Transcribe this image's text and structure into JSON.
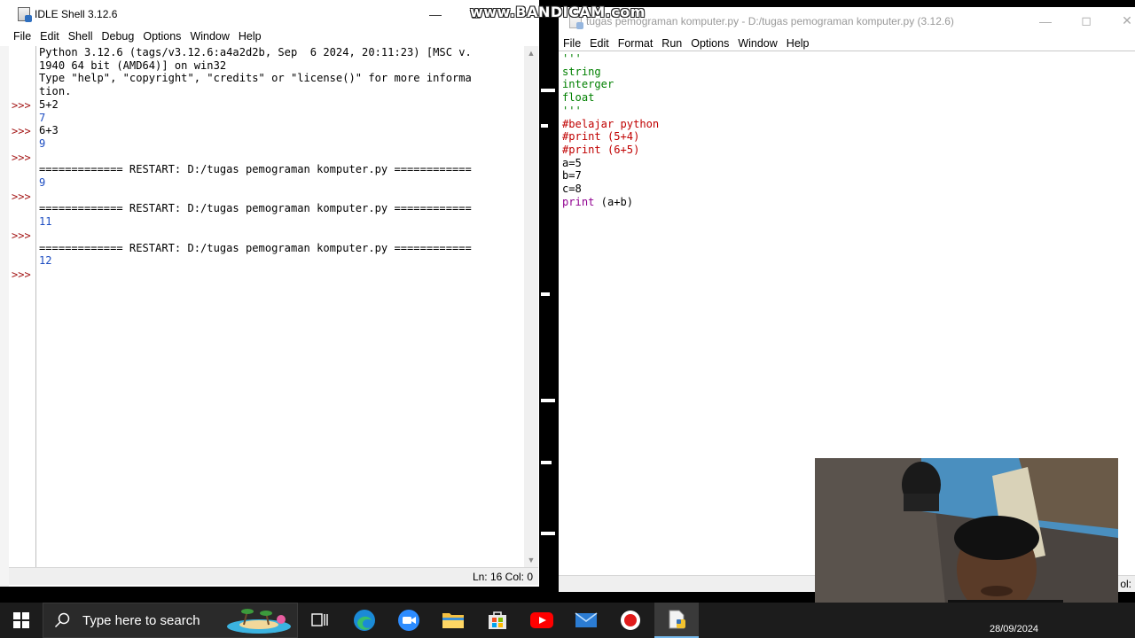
{
  "shell_window": {
    "title": "IDLE Shell 3.12.6",
    "menu": [
      "File",
      "Edit",
      "Shell",
      "Debug",
      "Options",
      "Window",
      "Help"
    ],
    "prompt": ">>>",
    "lines": [
      {
        "text": "Python 3.12.6 (tags/v3.12.6:a4a2d2b, Sep  6 2024, 20:11:23) [MSC v.",
        "kind": "plain"
      },
      {
        "text": "1940 64 bit (AMD64)] on win32",
        "kind": "plain"
      },
      {
        "text": "Type \"help\", \"copyright\", \"credits\" or \"license()\" for more informa",
        "kind": "plain"
      },
      {
        "text": "tion.",
        "kind": "plain"
      },
      {
        "text": "5+2",
        "kind": "input"
      },
      {
        "text": "7",
        "kind": "output"
      },
      {
        "text": "6+3",
        "kind": "input"
      },
      {
        "text": "9",
        "kind": "output"
      },
      {
        "text": "",
        "kind": "input"
      },
      {
        "text": "============= RESTART: D:/tugas pemograman komputer.py ============",
        "kind": "plain"
      },
      {
        "text": "9",
        "kind": "output"
      },
      {
        "text": "",
        "kind": "input"
      },
      {
        "text": "============= RESTART: D:/tugas pemograman komputer.py ============",
        "kind": "plain"
      },
      {
        "text": "11",
        "kind": "output"
      },
      {
        "text": "",
        "kind": "input"
      },
      {
        "text": "============= RESTART: D:/tugas pemograman komputer.py ============",
        "kind": "plain"
      },
      {
        "text": "12",
        "kind": "output"
      },
      {
        "text": "",
        "kind": "input"
      }
    ],
    "status": "Ln: 16   Col: 0"
  },
  "editor_window": {
    "title": "tugas pemograman komputer.py - D:/tugas pemograman komputer.py (3.12.6)",
    "menu": [
      "File",
      "Edit",
      "Format",
      "Run",
      "Options",
      "Window",
      "Help"
    ],
    "lines": [
      {
        "text": "'''",
        "kind": "str"
      },
      {
        "text": "string",
        "kind": "str"
      },
      {
        "text": "interger",
        "kind": "str"
      },
      {
        "text": "float",
        "kind": "str"
      },
      {
        "text": "'''",
        "kind": "str"
      },
      {
        "text": "#belajar python",
        "kind": "comment"
      },
      {
        "text": "#print (5+4)",
        "kind": "comment"
      },
      {
        "text": "#print (6+5)",
        "kind": "comment"
      },
      {
        "text": "a=5",
        "kind": "plain"
      },
      {
        "text": "b=7",
        "kind": "plain"
      },
      {
        "text": "c=8",
        "kind": "plain"
      },
      {
        "text": "print (a+b)",
        "kind": "builtin_call",
        "keyword": "print",
        "rest": " (a+b)"
      }
    ],
    "status": "ol:"
  },
  "watermark": "www.BANDICAM.com",
  "taskbar": {
    "search_placeholder": "Type here to search",
    "date": "28/09/2024",
    "icons": [
      "task-view-icon",
      "edge-icon",
      "zoom-icon",
      "file-explorer-icon",
      "store-icon",
      "youtube-icon",
      "mail-icon",
      "bandicam-record-icon",
      "idle-icon"
    ]
  },
  "colors": {
    "output": "#1e4ec2",
    "prompt": "#a31515",
    "string": "#008000",
    "comment": "#c00000",
    "builtin": "#900090",
    "taskbar": "#1c1c1c"
  }
}
